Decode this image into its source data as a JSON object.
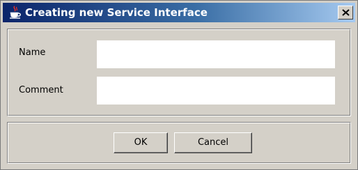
{
  "window": {
    "title": "Creating new Service Interface",
    "icon": "java-cup-icon",
    "close_icon": "close-icon"
  },
  "form": {
    "name_label": "Name",
    "name_value": "",
    "comment_label": "Comment",
    "comment_value": ""
  },
  "buttons": {
    "ok_label": "OK",
    "cancel_label": "Cancel"
  },
  "colors": {
    "title_gradient_start": "#0a246a",
    "title_gradient_end": "#a6caf0",
    "window_bg": "#d4d0c8"
  }
}
